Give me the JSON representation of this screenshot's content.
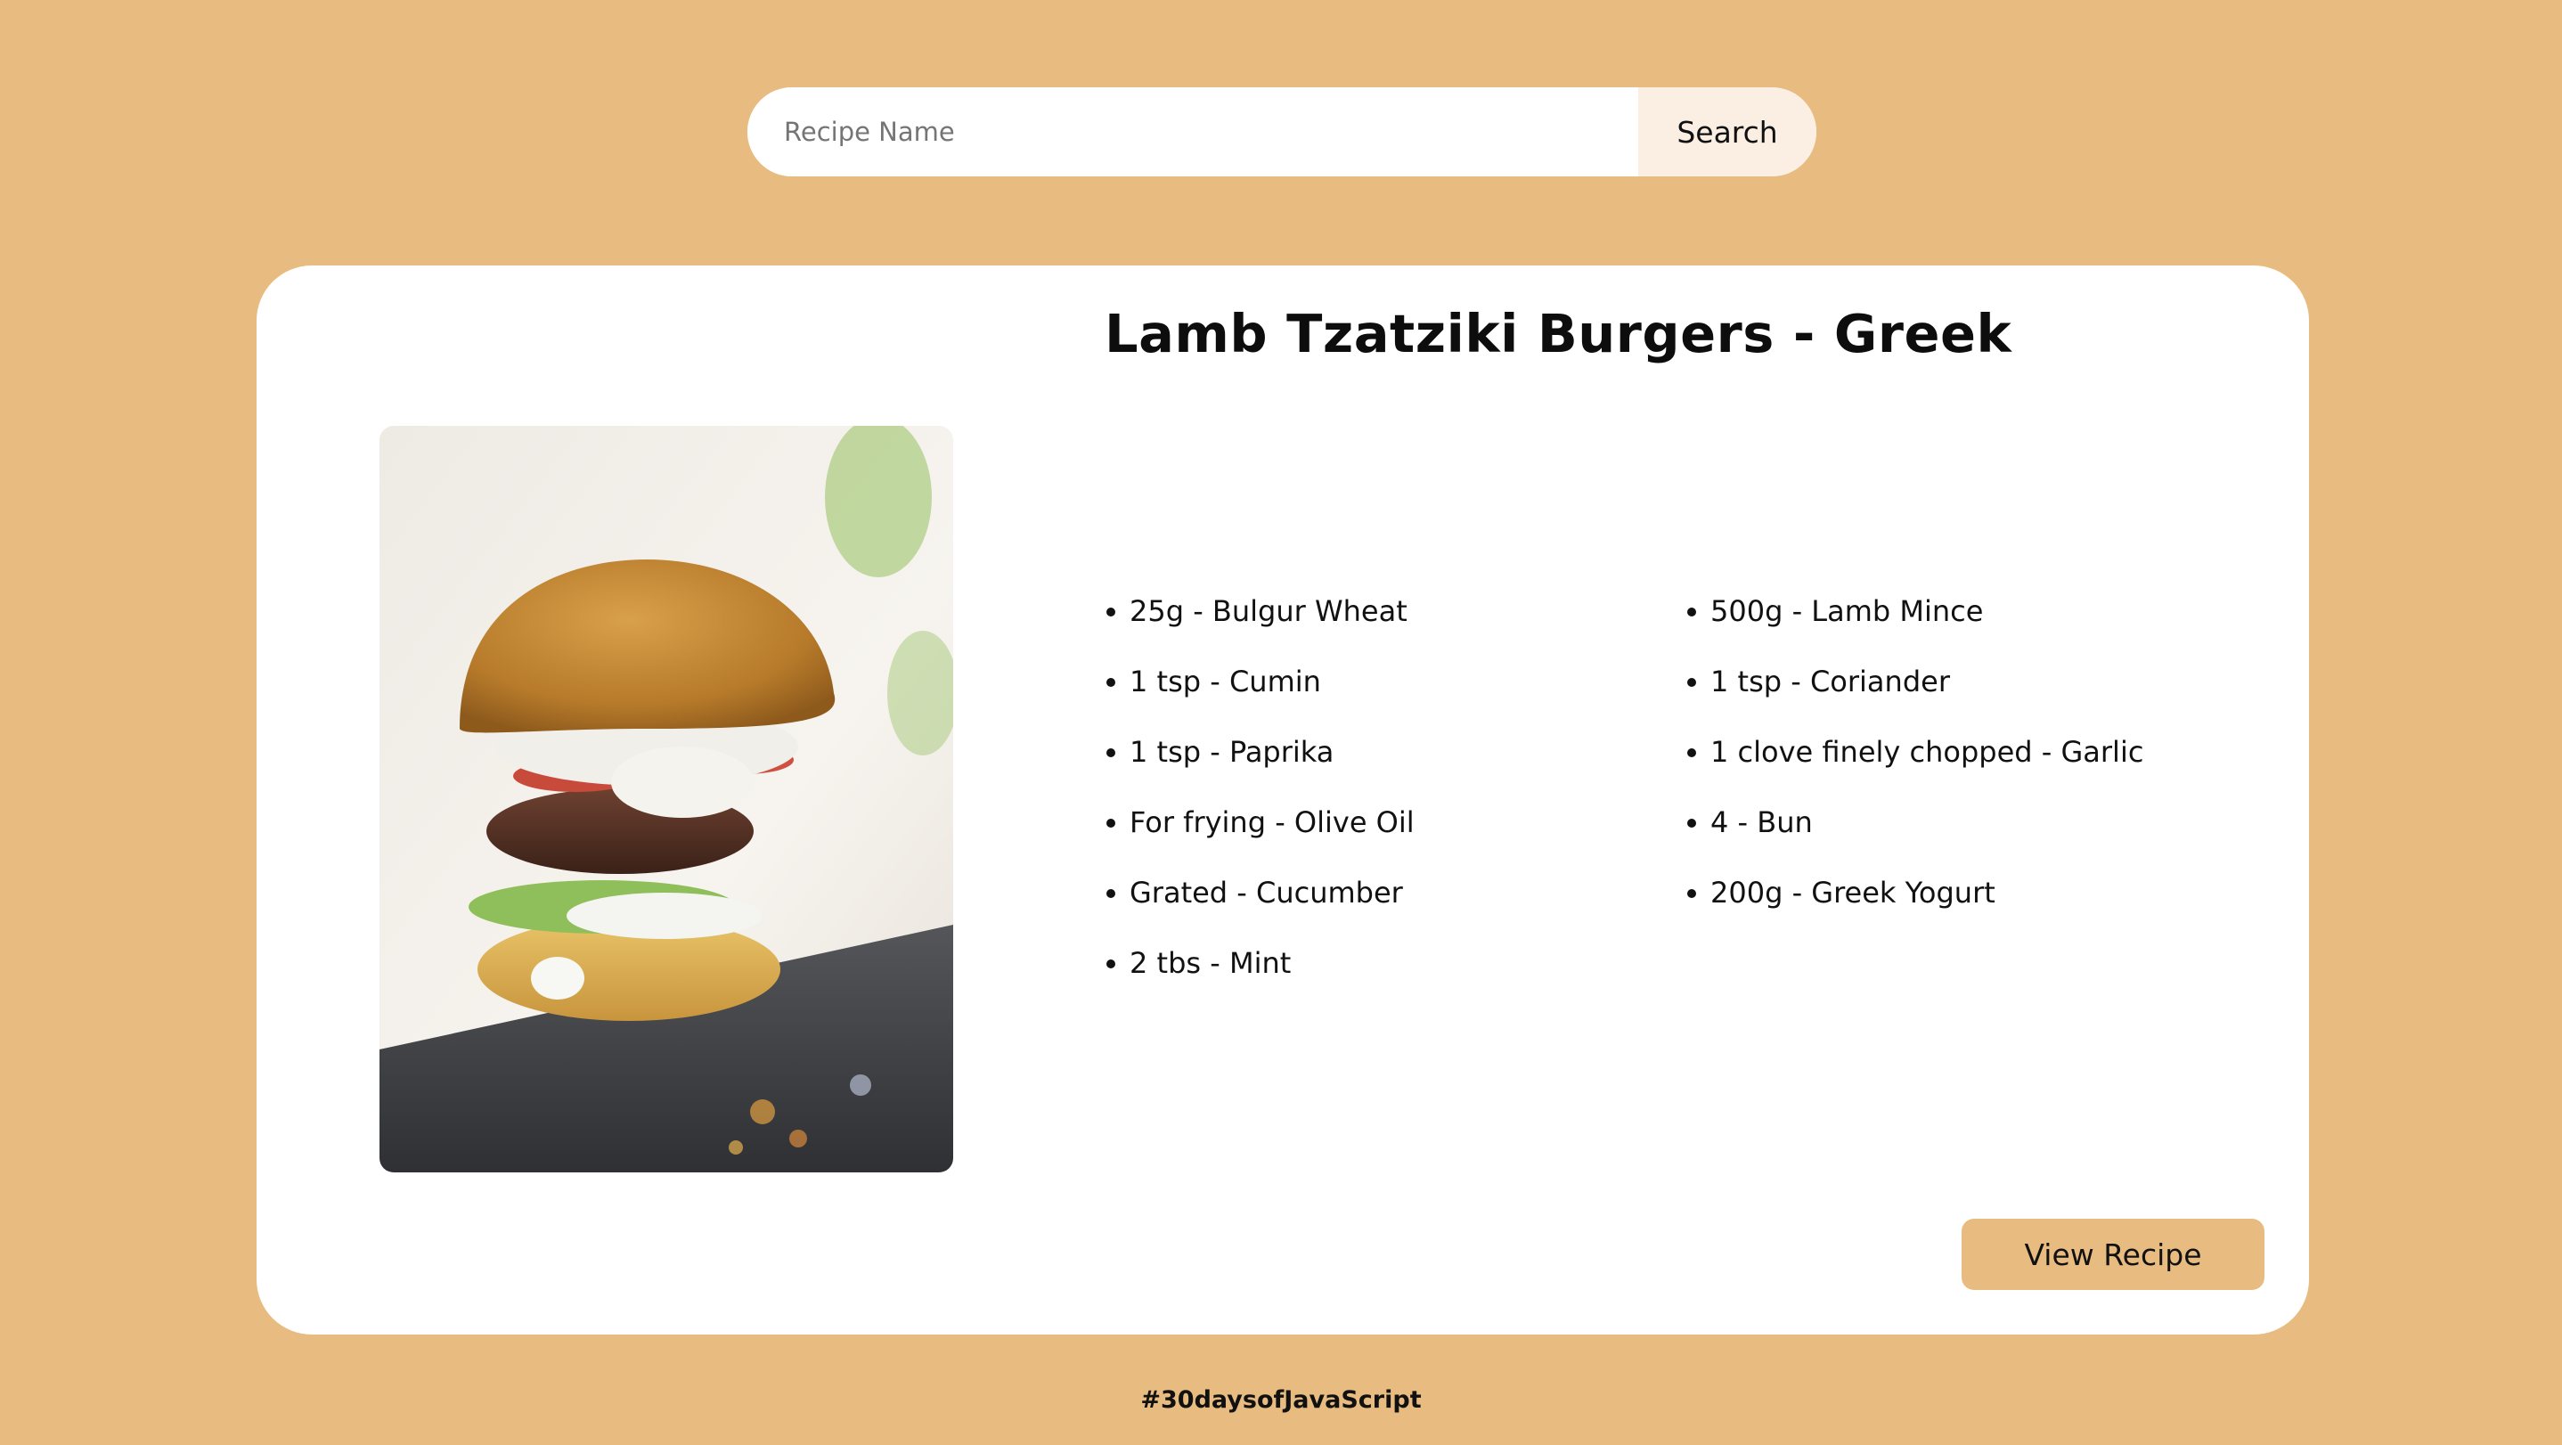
{
  "colors": {
    "background": "#e8bc80",
    "card": "#ffffff",
    "search_button_bg": "#fbefe3",
    "accent": "#e8bc80"
  },
  "search": {
    "placeholder": "Recipe Name",
    "value": "",
    "button_label": "Search"
  },
  "recipe": {
    "title": "Lamb Tzatziki Burgers - Greek",
    "image_icon": "burger-photo",
    "ingredients_left": [
      "25g - Bulgur Wheat",
      "1 tsp - Cumin",
      "1 tsp - Paprika",
      "For frying - Olive Oil",
      "Grated - Cucumber",
      "2 tbs - Mint"
    ],
    "ingredients_right": [
      "500g - Lamb Mince",
      "1 tsp - Coriander",
      "1 clove finely chopped - Garlic",
      "4 - Bun",
      "200g - Greek Yogurt"
    ],
    "view_button_label": "View Recipe"
  },
  "footer": {
    "text": "#30daysofJavaScript"
  }
}
